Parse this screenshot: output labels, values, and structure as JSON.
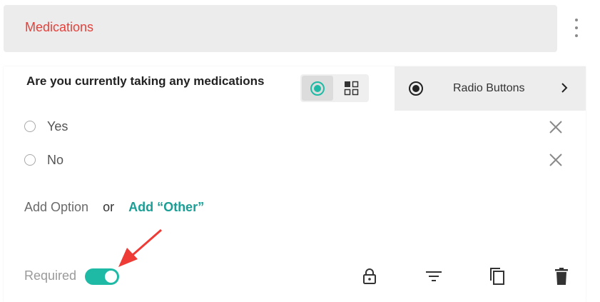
{
  "section": {
    "title": "Medications"
  },
  "question": {
    "text": "Are you currently taking any medications"
  },
  "field_type": {
    "label": "Radio Buttons"
  },
  "options": [
    {
      "label": "Yes"
    },
    {
      "label": "No"
    }
  ],
  "add": {
    "option_label": "Add Option",
    "or_label": "or",
    "other_label": "Add “Other”"
  },
  "required": {
    "label": "Required",
    "enabled": true
  },
  "colors": {
    "accent": "#1fbaa5",
    "title": "#e5403a",
    "annotation_arrow": "#ef3b36"
  }
}
